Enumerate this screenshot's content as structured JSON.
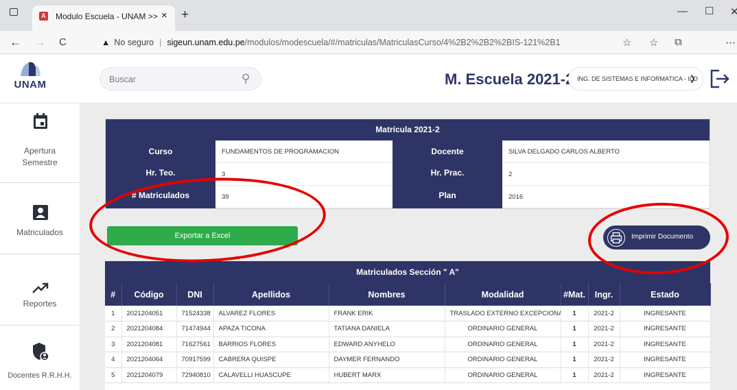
{
  "browser": {
    "tab_title": "Modulo Escuela - UNAM >>",
    "tab_close": "×",
    "new_tab": "+",
    "security": "No seguro",
    "url_host": "sigeun.unam.edu.pe",
    "url_path": "/modulos/modescuela/#/matriculas/MatriculasCurso/4%2B2%2B2%2BIS-121%2B1"
  },
  "header": {
    "logo_text": "UNAM",
    "search_placeholder": "Buscar",
    "school_title": "M. Escuela 2021-2",
    "career_select": "ING. DE SISTEMAS E INFORMATICA - ILO"
  },
  "sidebar": {
    "items": [
      {
        "label": "Apertura Semestre"
      },
      {
        "label": "Matriculados"
      },
      {
        "label": "Reportes"
      },
      {
        "label": "Docentes R.R.H.H."
      }
    ]
  },
  "course_card": {
    "title": "Matrícula 2021-2",
    "curso_label": "Curso",
    "curso_value": "FUNDAMENTOS DE PROGRAMACION",
    "docente_label": "Docente",
    "docente_value": "SILVA DELGADO CARLOS ALBERTO",
    "hrteo_label": "Hr. Teo.",
    "hrteo_value": "3",
    "hrprac_label": "Hr. Prac.",
    "hrprac_value": "2",
    "matric_label": "# Matriculados",
    "matric_value": "39",
    "plan_label": "Plan",
    "plan_value": "2016"
  },
  "actions": {
    "export_label": "Exportar a Excel",
    "print_label": "Imprimir Documento"
  },
  "students_table": {
    "title": "Matriculados Sección \" A\"",
    "columns": [
      "#",
      "Código",
      "DNI",
      "Apellidos",
      "Nombres",
      "Modalidad",
      "#Mat.",
      "Ingr.",
      "Estado"
    ],
    "rows": [
      [
        "1",
        "2021204051",
        "71524338",
        "ALVAREZ FLORES",
        "FRANK ERIK",
        "TRASLADO EXTERNO EXCEPCIONAL",
        "1",
        "2021-2",
        "INGRESANTE"
      ],
      [
        "2",
        "2021204084",
        "71474944",
        "APAZA TICONA",
        "TATIANA DANIELA",
        "ORDINARIO GENERAL",
        "1",
        "2021-2",
        "INGRESANTE"
      ],
      [
        "3",
        "2021204081",
        "71627561",
        "BARRIOS FLORES",
        "EDWARD ANYHELO",
        "ORDINARIO GENERAL",
        "1",
        "2021-2",
        "INGRESANTE"
      ],
      [
        "4",
        "2021204064",
        "70917599",
        "CABRERA QUISPE",
        "DAYMER FERNANDO",
        "ORDINARIO GENERAL",
        "1",
        "2021-2",
        "INGRESANTE"
      ],
      [
        "5",
        "2021204079",
        "72940810",
        "CALAVELLI HUASCUPE",
        "HUBERT MARX",
        "ORDINARIO GENERAL",
        "1",
        "2021-2",
        "INGRESANTE"
      ]
    ]
  },
  "colors": {
    "navy": "#2e3566",
    "green": "#2eab4b",
    "annotation_red": "#e60000"
  }
}
